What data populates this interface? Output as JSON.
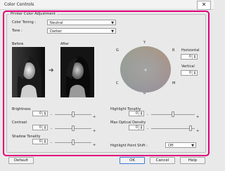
{
  "window": {
    "title": "Color Controls",
    "close": "✕"
  },
  "group_title": "Printer Color Adjustment",
  "color_toning": {
    "label": "Color Toning :",
    "value": "Neutral"
  },
  "tone": {
    "label": "Tone :",
    "value": "Darker"
  },
  "preview": {
    "before": "Before",
    "after": "After"
  },
  "wheel": {
    "top": "Y",
    "right_top": "R",
    "right_bottom": "M",
    "bottom": "B",
    "left_bottom": "C",
    "left_top": "G"
  },
  "horizontal": {
    "label": "Horizontal",
    "value": "0"
  },
  "vertical": {
    "label": "Vertical",
    "value": "0"
  },
  "brightness": {
    "label": "Brightness",
    "value": "0",
    "minus": "-",
    "plus": "+",
    "level": 0.5
  },
  "contrast": {
    "label": "Contrast",
    "value": "0",
    "minus": "-",
    "plus": "+",
    "level": 0.5
  },
  "shadow": {
    "label": "Shadow Tonality",
    "value": "0",
    "minus": "-",
    "plus": "+",
    "level": 0.5
  },
  "highlight": {
    "label": "Highlight Tonality",
    "value": "0",
    "minus": "-",
    "plus": "+",
    "level": 0.5
  },
  "max_density": {
    "label": "Max Optical Density",
    "value": "0",
    "minus": "-",
    "plus": "+",
    "level": 0.9
  },
  "highlight_point": {
    "label": "Highlight Point Shift :",
    "value": "Off"
  },
  "buttons": {
    "default": "Default",
    "ok": "OK",
    "cancel": "Cancel",
    "help": "Help"
  },
  "colors": {
    "accent": "#e0007c",
    "wheel_center": "#a3a3a3",
    "wheel_edge": "#7a9a7c"
  }
}
